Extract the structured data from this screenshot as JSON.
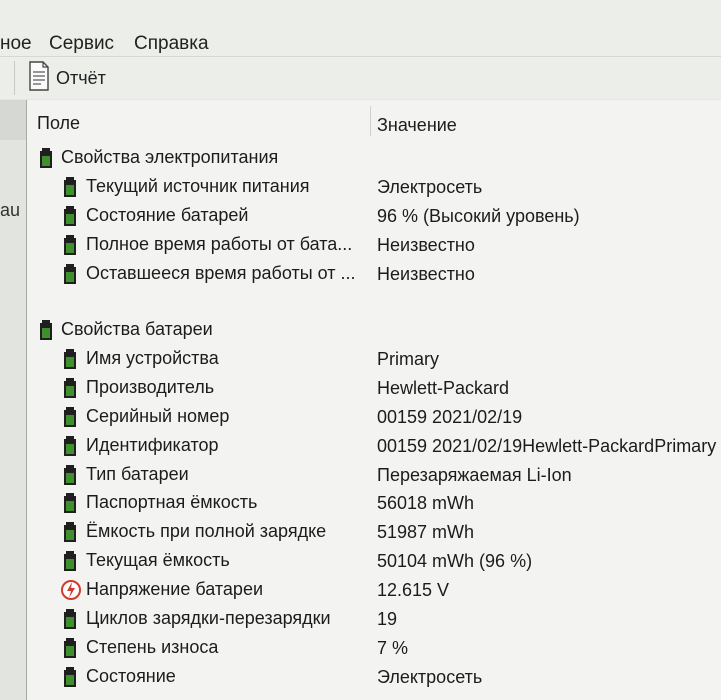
{
  "menu": {
    "items": [
      {
        "label": "ное"
      },
      {
        "label": "Сервис"
      },
      {
        "label": "Справка"
      }
    ]
  },
  "toolbar": {
    "report_label": "Отчёт"
  },
  "left_pane": {
    "fragment": "au"
  },
  "table": {
    "col_field": "Поле",
    "col_value": "Значение",
    "sections": [
      {
        "title": "Свойства электропитания",
        "rows": [
          {
            "name": "Текущий источник питания",
            "value": "Электросеть",
            "icon": "battery-icon"
          },
          {
            "name": "Состояние батарей",
            "value": "96 % (Высокий уровень)",
            "icon": "battery-icon"
          },
          {
            "name": "Полное время работы от бата...",
            "value": "Неизвестно",
            "icon": "battery-icon"
          },
          {
            "name": "Оставшееся время работы от ...",
            "value": "Неизвестно",
            "icon": "battery-icon"
          }
        ]
      },
      {
        "title": "Свойства батареи",
        "rows": [
          {
            "name": "Имя устройства",
            "value": "Primary",
            "icon": "battery-icon"
          },
          {
            "name": "Производитель",
            "value": "Hewlett-Packard",
            "icon": "battery-icon"
          },
          {
            "name": "Серийный номер",
            "value": "00159 2021/02/19",
            "icon": "battery-icon"
          },
          {
            "name": "Идентификатор",
            "value": "00159 2021/02/19Hewlett-PackardPrimary",
            "icon": "battery-icon"
          },
          {
            "name": "Тип батареи",
            "value": "Перезаряжаемая Li-Ion",
            "icon": "battery-icon"
          },
          {
            "name": "Паспортная ёмкость",
            "value": "56018 mWh",
            "icon": "battery-icon"
          },
          {
            "name": "Ёмкость при полной зарядке",
            "value": "51987 mWh",
            "icon": "battery-icon"
          },
          {
            "name": "Текущая ёмкость",
            "value": "50104 mWh  (96 %)",
            "icon": "battery-icon"
          },
          {
            "name": "Напряжение батареи",
            "value": "12.615 V",
            "icon": "voltage-icon"
          },
          {
            "name": "Циклов зарядки-перезарядки",
            "value": "19",
            "icon": "battery-icon"
          },
          {
            "name": "Степень износа",
            "value": "7 %",
            "icon": "battery-icon"
          },
          {
            "name": "Состояние",
            "value": "Электросеть",
            "icon": "battery-icon"
          }
        ]
      }
    ]
  },
  "colors": {
    "battery_green": "#3f8f2c",
    "battery_dark": "#1f1f1f",
    "voltage_red": "#d23a2a",
    "background": "#f3f4f1"
  }
}
